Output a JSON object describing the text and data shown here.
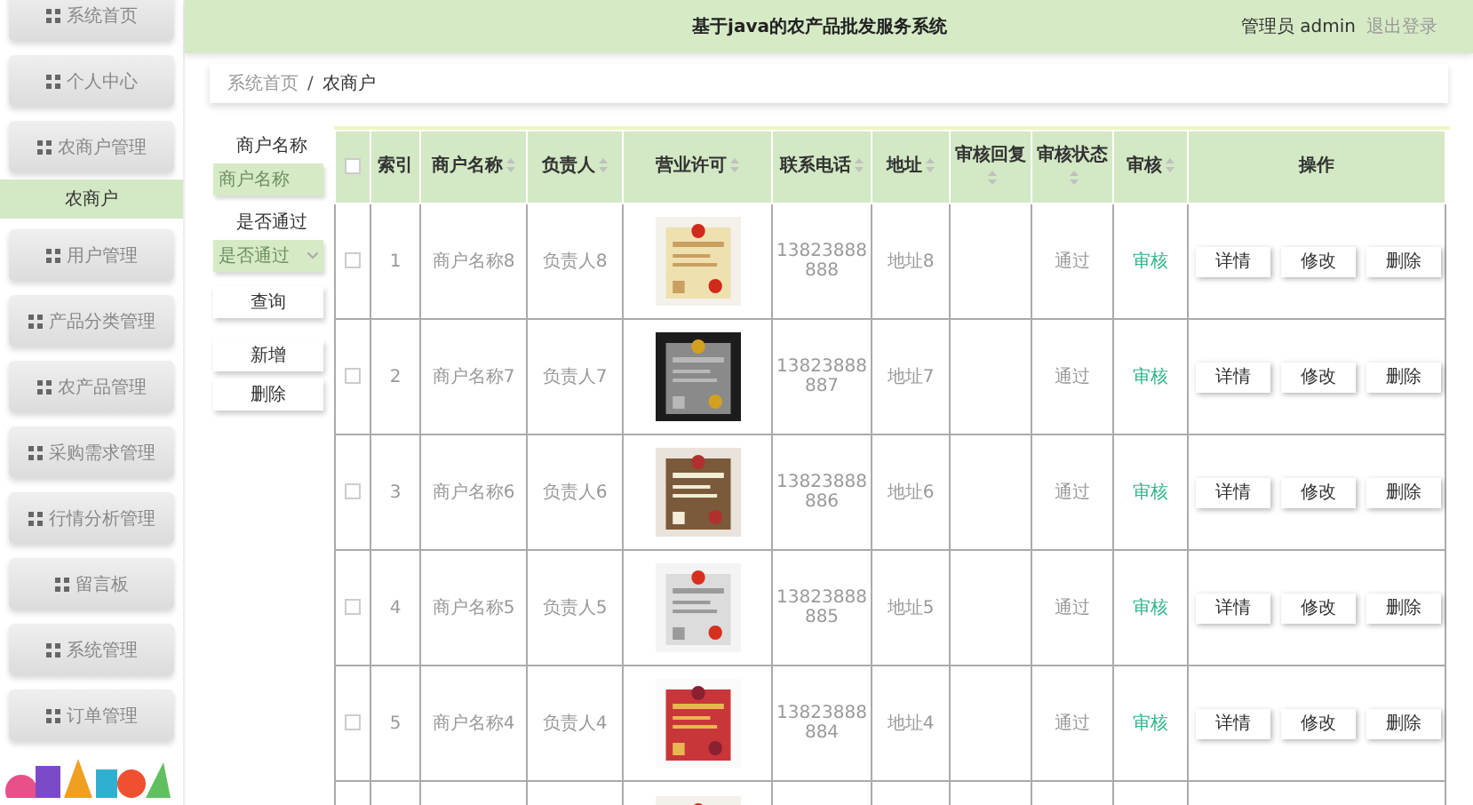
{
  "sidebar": {
    "items": [
      {
        "label": "系统首页",
        "selected": false
      },
      {
        "label": "个人中心",
        "selected": false
      },
      {
        "label": "农商户管理",
        "selected": false,
        "children": [
          {
            "label": "农商户",
            "selected": true
          }
        ]
      },
      {
        "label": "用户管理",
        "selected": false
      },
      {
        "label": "产品分类管理",
        "selected": false
      },
      {
        "label": "农产品管理",
        "selected": false
      },
      {
        "label": "采购需求管理",
        "selected": false
      },
      {
        "label": "行情分析管理",
        "selected": false
      },
      {
        "label": "留言板",
        "selected": false
      },
      {
        "label": "系统管理",
        "selected": false
      },
      {
        "label": "订单管理",
        "selected": false
      }
    ]
  },
  "header": {
    "title": "基于java的农产品批发服务系统",
    "user": "管理员 admin",
    "logout": "退出登录"
  },
  "breadcrumb": [
    "系统首页",
    "农商户"
  ],
  "breadcrumb_separator": "/",
  "search": {
    "fields": [
      {
        "label": "商户名称",
        "kind": "input",
        "placeholder": "商户名称"
      },
      {
        "label": "是否通过",
        "kind": "select",
        "placeholder": "是否通过"
      }
    ],
    "buttons": [
      "查询",
      "新增",
      "删除"
    ]
  },
  "table": {
    "select_all": {
      "checked": false
    },
    "columns": [
      {
        "label": "索引",
        "sortable": false
      },
      {
        "label": "商户名称",
        "sortable": true
      },
      {
        "label": "负责人",
        "sortable": true
      },
      {
        "label": "营业许可",
        "sortable": true
      },
      {
        "label": "联系电话",
        "sortable": true
      },
      {
        "label": "地址",
        "sortable": true
      },
      {
        "label": "审核回复",
        "sortable": true
      },
      {
        "label": "审核状态",
        "sortable": true
      },
      {
        "label": "审核",
        "sortable": true
      },
      {
        "label": "操作",
        "sortable": false
      }
    ],
    "rows": [
      {
        "checked": false,
        "index": "1",
        "name": "商户名称8",
        "person": "负责人8",
        "phone": "13823888888",
        "address": "地址8",
        "reply": "",
        "status": "通过",
        "audit": "审核",
        "actions": [
          "详情",
          "修改",
          "删除"
        ]
      },
      {
        "checked": false,
        "index": "2",
        "name": "商户名称7",
        "person": "负责人7",
        "phone": "13823888887",
        "address": "地址7",
        "reply": "",
        "status": "通过",
        "audit": "审核",
        "actions": [
          "详情",
          "修改",
          "删除"
        ]
      },
      {
        "checked": false,
        "index": "3",
        "name": "商户名称6",
        "person": "负责人6",
        "phone": "13823888886",
        "address": "地址6",
        "reply": "",
        "status": "通过",
        "audit": "审核",
        "actions": [
          "详情",
          "修改",
          "删除"
        ]
      },
      {
        "checked": false,
        "index": "4",
        "name": "商户名称5",
        "person": "负责人5",
        "phone": "13823888885",
        "address": "地址5",
        "reply": "",
        "status": "通过",
        "audit": "审核",
        "actions": [
          "详情",
          "修改",
          "删除"
        ]
      },
      {
        "checked": false,
        "index": "5",
        "name": "商户名称4",
        "person": "负责人4",
        "phone": "13823888884",
        "address": "地址4",
        "reply": "",
        "status": "通过",
        "audit": "审核",
        "actions": [
          "详情",
          "修改",
          "删除"
        ]
      }
    ]
  }
}
